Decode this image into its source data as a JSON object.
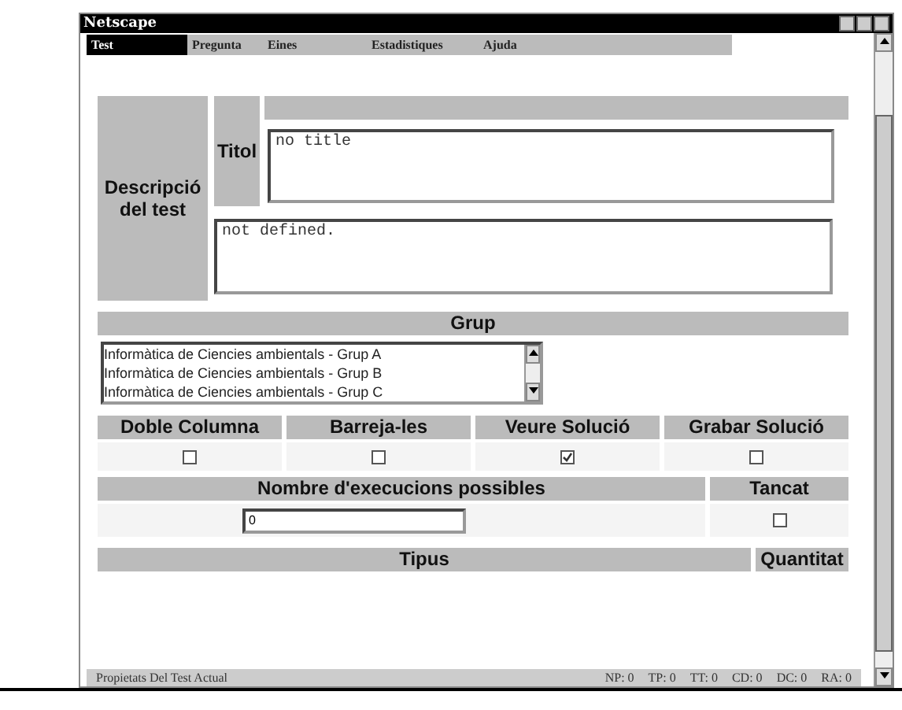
{
  "window": {
    "title": "Netscape"
  },
  "menu": [
    {
      "label": "Test",
      "selected": true
    },
    {
      "label": "Pregunta",
      "selected": false
    },
    {
      "label": "Eines",
      "selected": false
    },
    {
      "label": "Estadistiques",
      "selected": false
    },
    {
      "label": "Ajuda",
      "selected": false
    }
  ],
  "description": {
    "label": "Descripció del test",
    "title_label": "Titol",
    "title_value": "no title",
    "description_value": "not defined."
  },
  "group": {
    "header": "Grup",
    "options": [
      "Informàtica de Ciencies ambientals - Grup A",
      "Informàtica de Ciencies ambientals - Grup B",
      "Informàtica de Ciencies ambientals - Grup C"
    ]
  },
  "options": [
    {
      "label": "Doble Columna",
      "checked": false
    },
    {
      "label": "Barreja-les",
      "checked": false
    },
    {
      "label": "Veure Solució",
      "checked": true
    },
    {
      "label": "Grabar Solució",
      "checked": false
    }
  ],
  "executions": {
    "label": "Nombre d'execucions possibles",
    "value": "0",
    "closed_label": "Tancat",
    "closed": false
  },
  "types": {
    "columns": [
      "Tipus",
      "Quantitat"
    ]
  },
  "status_bar": {
    "text": "Propietats Del Test Actual",
    "counters": [
      "NP: 0",
      "TP: 0",
      "TT: 0",
      "CD: 0",
      "DC: 0",
      "RA: 0"
    ]
  }
}
